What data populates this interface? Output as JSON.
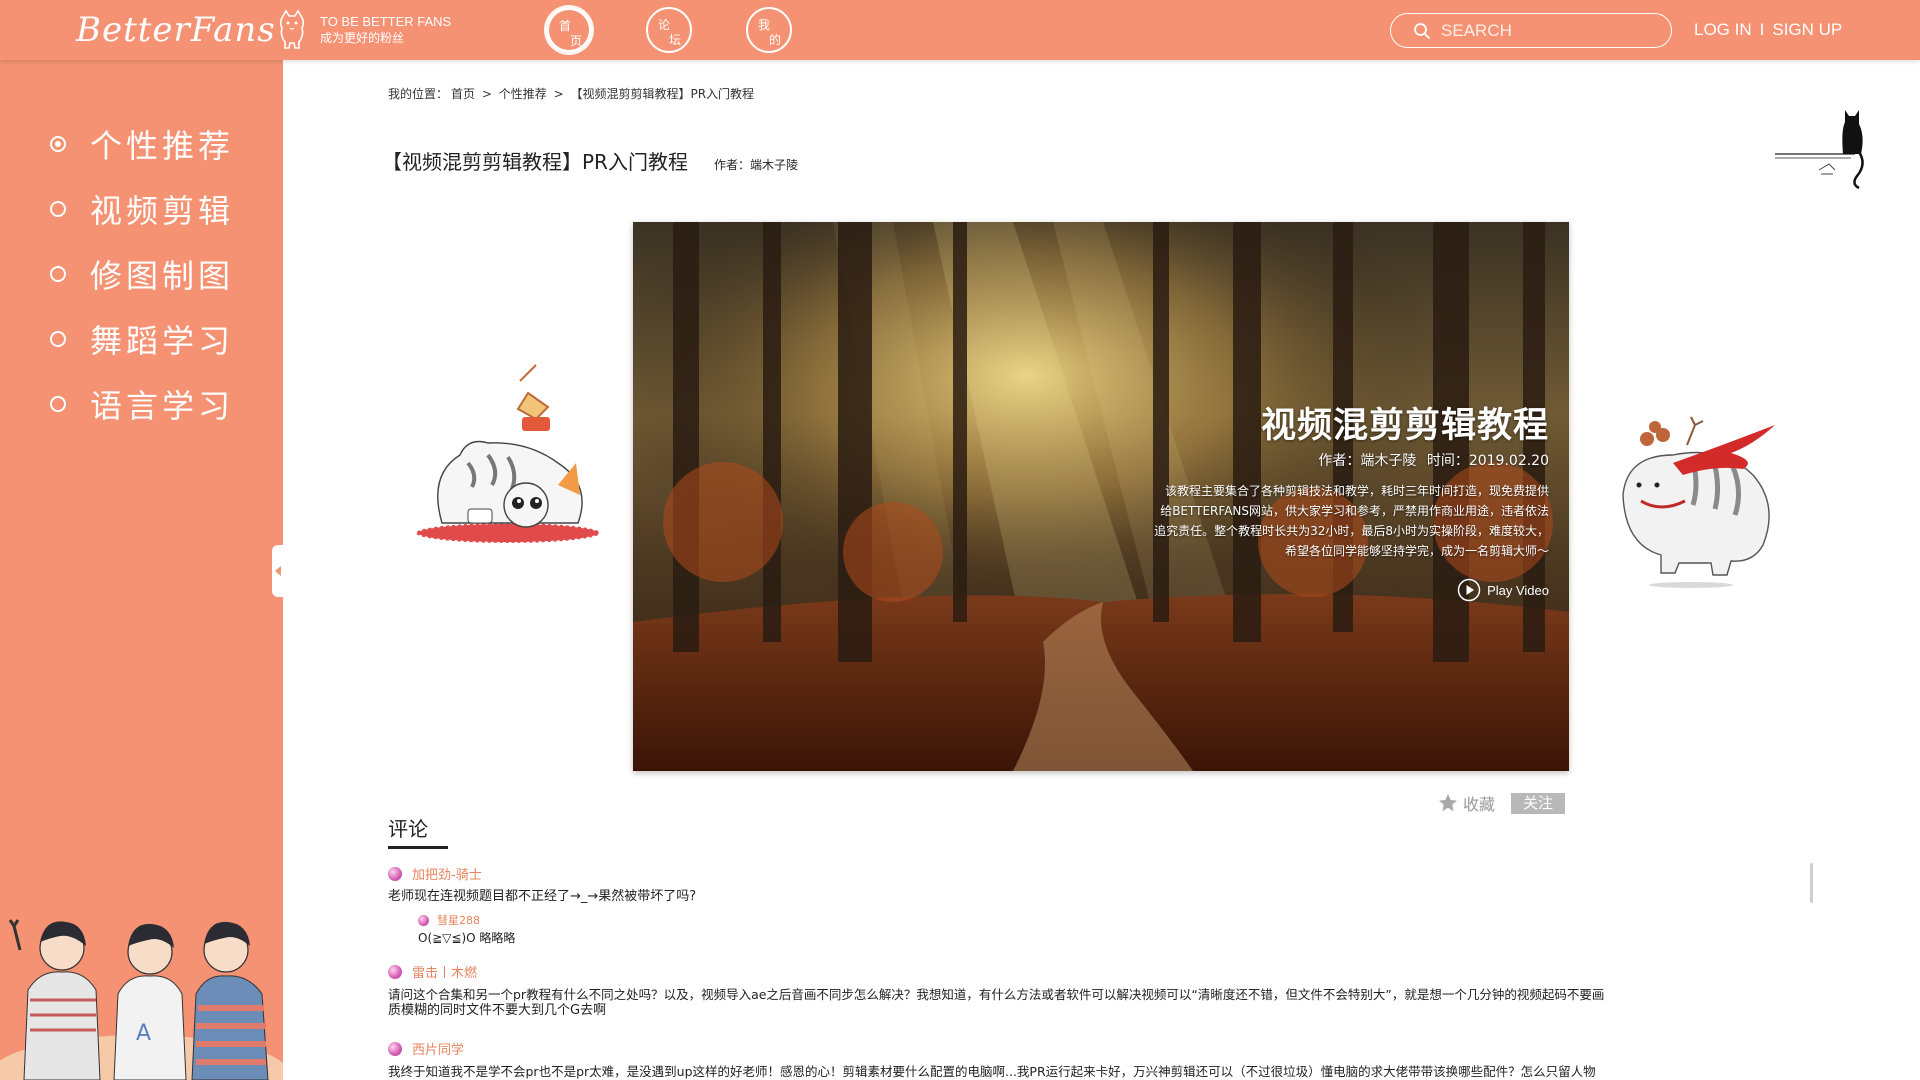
{
  "header": {
    "logo": "BetterFans",
    "tagline_en": "TO BE BETTER FANS",
    "tagline_cn": "成为更好的粉丝",
    "nav": [
      {
        "line1": "首",
        "line2": "页"
      },
      {
        "line1": "论",
        "line2": "坛"
      },
      {
        "line1": "我",
        "line2": "的"
      }
    ],
    "search_placeholder": "SEARCH",
    "login": "LOG IN",
    "separator": "I",
    "signup": "SIGN UP"
  },
  "sidebar": {
    "items": [
      {
        "label": "个性推荐"
      },
      {
        "label": "视频剪辑"
      },
      {
        "label": "修图制图"
      },
      {
        "label": "舞蹈学习"
      },
      {
        "label": "语言学习"
      }
    ]
  },
  "breadcrumb": {
    "prefix": "我的位置：",
    "home": "首页",
    "sep": ">",
    "category": "个性推荐",
    "current": "【视频混剪剪辑教程】PR入门教程"
  },
  "article": {
    "title": "【视频混剪剪辑教程】PR入门教程",
    "author_label": "作者：",
    "author": "端木子陵"
  },
  "banner": {
    "title": "视频混剪剪辑教程",
    "meta_author": "作者：端木子陵",
    "meta_time": "时间：2019.02.20",
    "desc_lines": [
      "该教程主要集合了各种剪辑技法和教学，耗时三年时间打造，现免费提供",
      "给BETTERFANS网站，供大家学习和参考，严禁用作商业用途，违者依法",
      "追究责任。整个教程时长共为32小时，最后8小时为实操阶段，难度较大，",
      "希望各位同学能够坚持学完，成为一名剪辑大师～"
    ],
    "play": "Play Video"
  },
  "actions": {
    "favorite": "收藏",
    "follow": "关注"
  },
  "comments": {
    "title": "评论",
    "items": [
      {
        "user": "加把劲-骑士",
        "text": "老师现在连视频题目都不正经了→_→果然被带坏了吗?",
        "reply": {
          "user": "彗星288",
          "text": "O(≧▽≦)O 略略略"
        }
      },
      {
        "user": "雷击丨木燃",
        "text_lines": [
          "请问这个合集和另一个pr教程有什么不同之处吗？以及，视频导入ae之后音画不同步怎么解决？我想知道，有什么方法或者软件可以解决视频可以“清晰度还不错，但文件不会特别大”，就是想一个几分钟的视频起码不要画",
          "质模糊的同时文件不要大到几个G去啊"
        ]
      },
      {
        "user": "西片同学",
        "text": "我终于知道我不是学不会pr也不是pr太难，是没遇到up这样的好老师！感恩的心！剪辑素材要什么配置的电脑啊...我PR运行起来卡好，万兴神剪辑还可以（不过很垃圾）懂电脑的求大佬带带该换哪些配件？怎么只留人物"
      }
    ]
  },
  "colors": {
    "brand": "#f59273",
    "username": "#e7845f",
    "follow_bg": "#b8b8b8"
  }
}
